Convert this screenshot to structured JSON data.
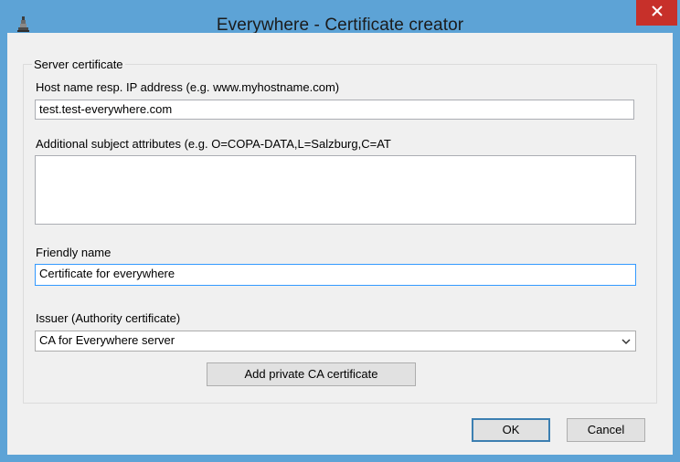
{
  "window": {
    "title": "Everywhere - Certificate creator",
    "icon": "app-icon",
    "close_icon": "close-icon"
  },
  "group": {
    "legend": "Server certificate"
  },
  "host": {
    "label": "Host name resp. IP address (e.g. www.myhostname.com)",
    "value": "test.test-everywhere.com"
  },
  "subject": {
    "label": "Additional subject attributes (e.g. O=COPA-DATA,L=Salzburg,C=AT",
    "value": ""
  },
  "friendly": {
    "label": "Friendly name",
    "value": "Certificate for everywhere"
  },
  "issuer": {
    "label": "Issuer (Authority certificate)",
    "selected": "CA for Everywhere server"
  },
  "buttons": {
    "add_ca": "Add private CA certificate",
    "ok": "OK",
    "cancel": "Cancel"
  },
  "colors": {
    "frame": "#5da3d6",
    "close": "#c7302a",
    "client": "#f0f0f0",
    "focus_border": "#3399ff"
  }
}
